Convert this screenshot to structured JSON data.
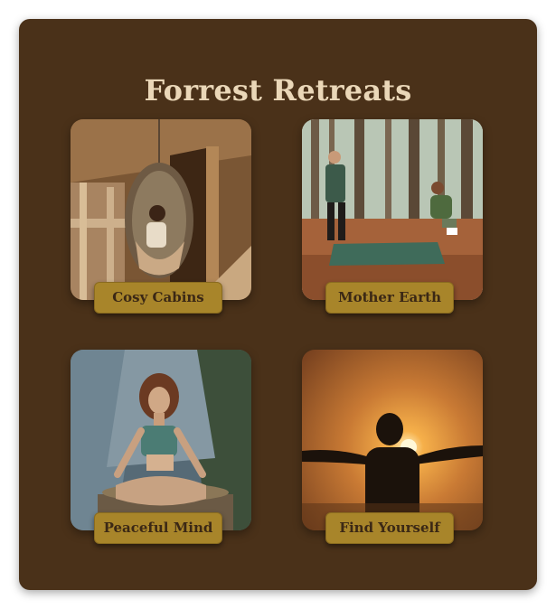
{
  "page": {
    "title": "Forrest Retreats"
  },
  "colors": {
    "background": "#ffffff",
    "card": "#4a3119",
    "title": "#ead7b8",
    "button": "#a8852a",
    "button_text": "#3b2815"
  },
  "retreats": [
    {
      "label": "Cosy Cabins",
      "image": "treehouse-cabin-hanging-chair-photo"
    },
    {
      "label": "Mother Earth",
      "image": "forest-couple-ground-mat-photo"
    },
    {
      "label": "Peaceful Mind",
      "image": "woman-meditating-on-rock-photo"
    },
    {
      "label": "Find Yourself",
      "image": "silhouette-open-arms-sunset-photo"
    }
  ]
}
